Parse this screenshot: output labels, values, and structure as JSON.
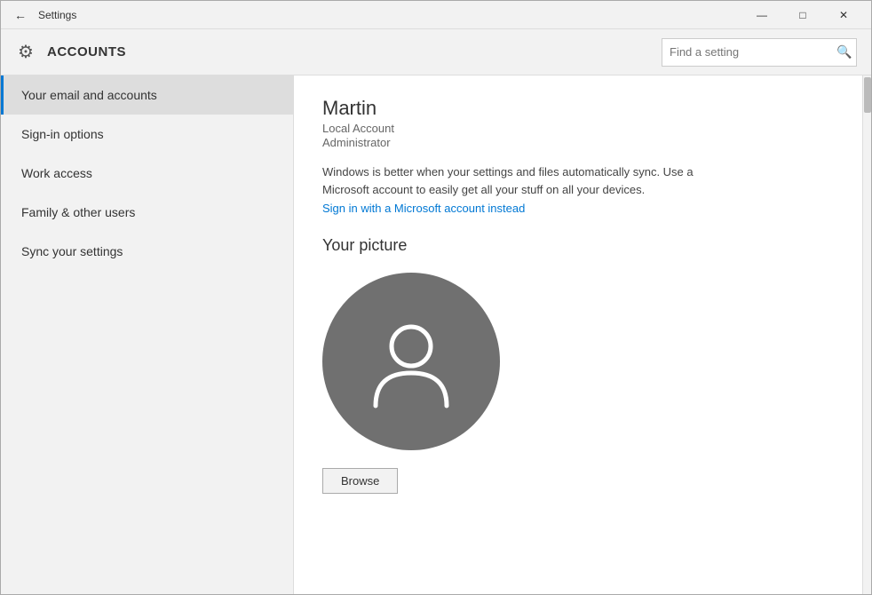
{
  "window": {
    "title": "Settings",
    "controls": {
      "minimize": "—",
      "maximize": "□",
      "close": "✕"
    }
  },
  "header": {
    "icon": "⚙",
    "title": "ACCOUNTS",
    "search_placeholder": "Find a setting",
    "search_icon": "🔍"
  },
  "sidebar": {
    "items": [
      {
        "label": "Your email and accounts",
        "active": true
      },
      {
        "label": "Sign-in options",
        "active": false
      },
      {
        "label": "Work access",
        "active": false
      },
      {
        "label": "Family & other users",
        "active": false
      },
      {
        "label": "Sync your settings",
        "active": false
      }
    ]
  },
  "content": {
    "user_name": "Martin",
    "user_account_type": "Local Account",
    "user_role": "Administrator",
    "sync_message": "Windows is better when your settings and files automatically sync. Use a Microsoft account to easily get all your stuff on all your devices.",
    "sign_in_link": "Sign in with a Microsoft account instead",
    "picture_section_title": "Your picture",
    "browse_button_label": "Browse"
  }
}
